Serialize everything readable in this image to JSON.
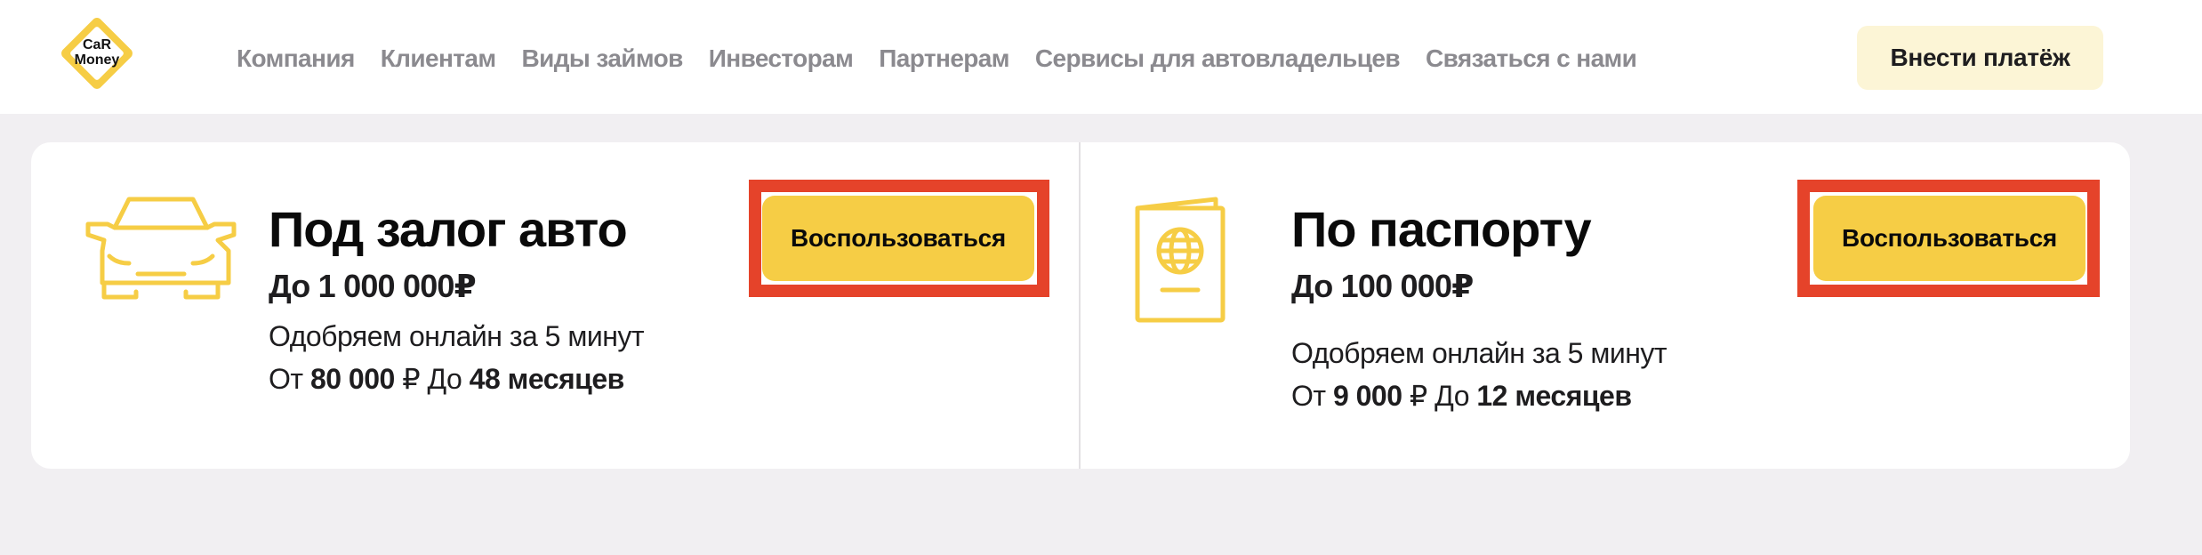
{
  "header": {
    "logo": {
      "line1": "CaR",
      "line2": "Money",
      "color": "#F6CD45"
    },
    "nav": [
      {
        "label": "Компания"
      },
      {
        "label": "Клиентам"
      },
      {
        "label": "Виды займов"
      },
      {
        "label": "Инвесторам"
      },
      {
        "label": "Партнерам"
      },
      {
        "label": "Сервисы для автовладельцев"
      },
      {
        "label": "Связаться с нами"
      }
    ],
    "pay_button": "Внести платёж"
  },
  "offers": [
    {
      "icon": "car-icon",
      "title": "Под залог авто",
      "amount": "До 1 000 000₽",
      "approval": "Одобряем онлайн за 5 минут",
      "terms": {
        "from_prefix": "От",
        "from_value": "80 000",
        "currency": "₽",
        "to_prefix": "До",
        "to_value": "48 месяцев"
      },
      "cta": "Воспользоваться",
      "highlighted": true
    },
    {
      "icon": "passport-icon",
      "title": "По паспорту",
      "amount": "До 100 000₽",
      "approval": "Одобряем онлайн за 5 минут",
      "terms": {
        "from_prefix": "От",
        "from_value": "9 000",
        "currency": "₽",
        "to_prefix": "До",
        "to_value": "12 месяцев"
      },
      "cta": "Воспользоваться",
      "highlighted": true
    }
  ],
  "colors": {
    "accent": "#F6CD45",
    "highlight_box": "#E5432A",
    "pay_button_bg": "#FCF5D6",
    "nav_text": "#8B8A8F",
    "page_bg": "#F1EFF2"
  }
}
